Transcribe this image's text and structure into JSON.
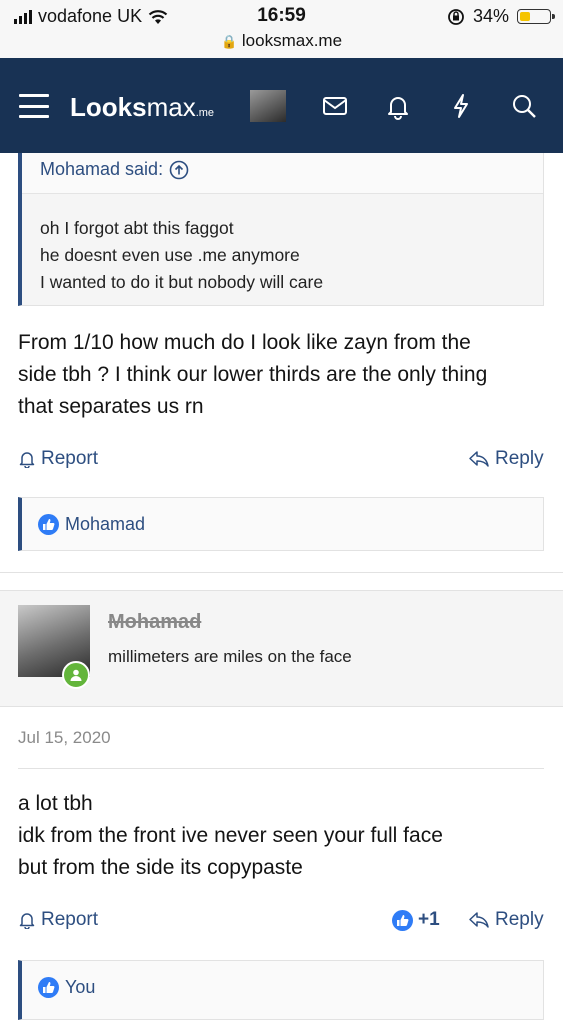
{
  "status_bar": {
    "carrier": "vodafone UK",
    "time": "16:59",
    "battery": "34%",
    "battery_level": 0.34,
    "url": "looksmax.me"
  },
  "nav": {
    "logo_bold": "Looks",
    "logo_rest": "max",
    "logo_suffix": ".me"
  },
  "quote": {
    "author": "Mohamad said:",
    "lines": [
      "oh I forgot abt this faggot",
      "he doesnt even use .me anymore",
      "I wanted to do it but nobody will care"
    ]
  },
  "post1": {
    "lines": [
      "From 1/10 how much do I look like zayn from the",
      "side tbh ? I think our lower thirds are the only thing",
      "that separates us rn"
    ],
    "report": "Report",
    "reply": "Reply",
    "reaction_user": "Mohamad"
  },
  "user": {
    "name": "Mohamad",
    "title": "millimeters are miles on the face"
  },
  "post2": {
    "date": "Jul 15, 2020",
    "lines": [
      "a lot tbh",
      "idk from the front ive never seen your full face",
      "but from the side its copypaste"
    ],
    "report": "Report",
    "likes": "+1",
    "reply": "Reply",
    "reaction_user": "You"
  },
  "colors": {
    "navbar": "#183254",
    "link": "#2d4e80",
    "like": "#2f7cf6",
    "online": "#63b53b",
    "battery": "#f5c400"
  }
}
